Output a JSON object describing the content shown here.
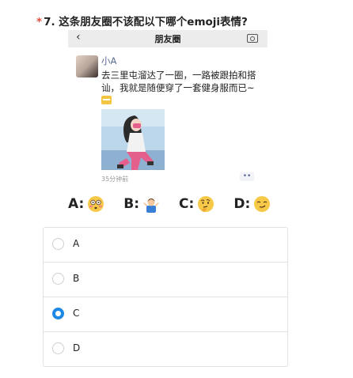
{
  "question": {
    "marker": "*",
    "text": "7. 这条朋友圈不该配以下哪个emoji表情?"
  },
  "moments": {
    "back_glyph": "‹",
    "title": "朋友圈",
    "username": "小A",
    "post_text": "去三里屯溜达了一圈，一路被跟拍和搭讪，我就是随便穿了一套健身服而已~",
    "timestamp": "35分钟前",
    "more_glyph": "••"
  },
  "emoji_options": [
    {
      "label": "A:",
      "emoji": "flushed-face"
    },
    {
      "label": "B:",
      "emoji": "person-shrugging"
    },
    {
      "label": "C:",
      "emoji": "thinking-face"
    },
    {
      "label": "D:",
      "emoji": "smirking-face"
    }
  ],
  "choices": [
    {
      "label": "A",
      "selected": false
    },
    {
      "label": "B",
      "selected": false
    },
    {
      "label": "C",
      "selected": true
    },
    {
      "label": "D",
      "selected": false
    }
  ],
  "colors": {
    "accent": "#1e88e5",
    "required": "#e74c3c",
    "username": "#576b95"
  }
}
